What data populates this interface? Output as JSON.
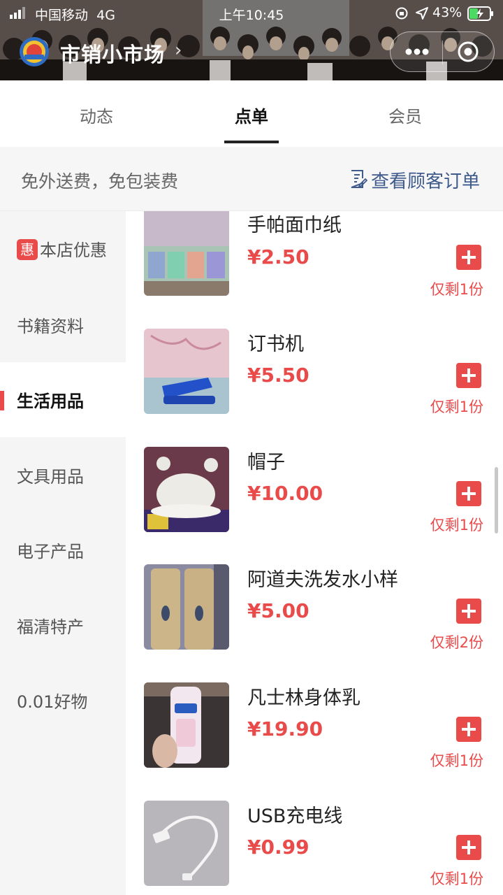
{
  "status_bar": {
    "carrier": "中国移动",
    "network": "4G",
    "time": "上午10:45",
    "battery": "43%",
    "battery_level": 0.43
  },
  "nav": {
    "title": "市销小市场",
    "chevron": "›",
    "icons": [
      "logo-emblem",
      "more-icon",
      "target-icon"
    ]
  },
  "tabs": [
    {
      "label": "动态",
      "active": false
    },
    {
      "label": "点单",
      "active": true
    },
    {
      "label": "会员",
      "active": false
    }
  ],
  "notice": {
    "text": "免外送费，免包装费",
    "orders_link": "查看顾客订单"
  },
  "sidebar": {
    "items": [
      {
        "label": "本店优惠",
        "badge": "惠"
      },
      {
        "label": "书籍资料"
      },
      {
        "label": "生活用品",
        "active": true
      },
      {
        "label": "文具用品"
      },
      {
        "label": "电子产品"
      },
      {
        "label": "福清特产"
      },
      {
        "label": "0.01好物"
      }
    ]
  },
  "products": [
    {
      "name": "手帕面巾纸",
      "price": "¥2.50",
      "stock": "仅剩1份"
    },
    {
      "name": "订书机",
      "price": "¥5.50",
      "stock": "仅剩1份"
    },
    {
      "name": "帽子",
      "price": "¥10.00",
      "stock": "仅剩1份"
    },
    {
      "name": "阿道夫洗发水小样",
      "price": "¥5.00",
      "stock": "仅剩2份"
    },
    {
      "name": "凡士林身体乳",
      "price": "¥19.90",
      "stock": "仅剩1份"
    },
    {
      "name": "USB充电线",
      "price": "¥0.99",
      "stock": "仅剩1份"
    }
  ],
  "colors": {
    "accent": "#e94b4b",
    "link": "#3f5a8c",
    "sidebar_bg": "#f5f5f5"
  }
}
